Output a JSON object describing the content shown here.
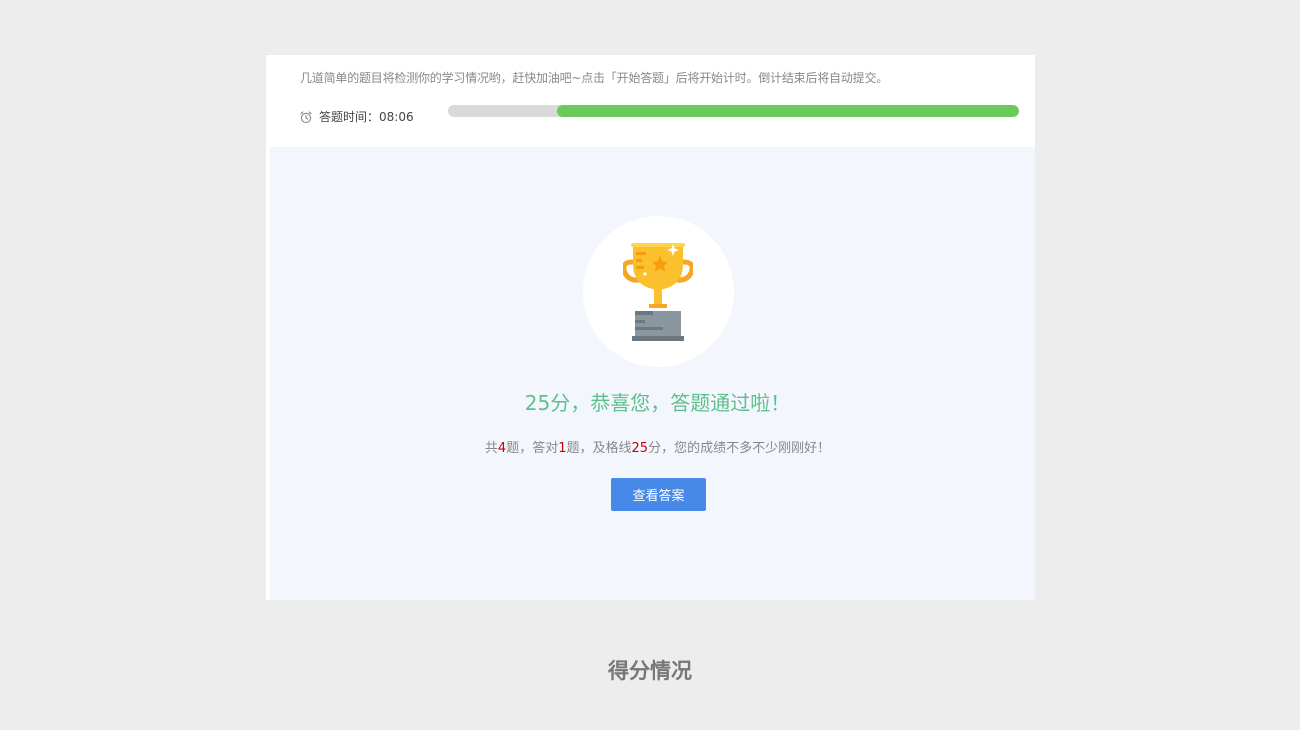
{
  "quiz": {
    "intro": "几道简单的题目将检测你的学习情况哟，赶快加油吧~点击「开始答题」后将开始计时。倒计结束后将自动提交。",
    "timer_label": "答题时间：",
    "timer_value": "08:06",
    "time_remaining_fraction": 0.81,
    "icons": {
      "timer": "alarm-clock-icon",
      "trophy": "trophy-icon"
    },
    "colors": {
      "progress_fill": "#6cc95c",
      "progress_track": "#d9d9d9",
      "title": "#5fbf8c",
      "highlight": "#cc0000",
      "button": "#4689e8"
    }
  },
  "result": {
    "title": "25分，恭喜您，答题通过啦！",
    "detail": {
      "p1": "共",
      "total": "4",
      "p2": "题，答对",
      "correct": "1",
      "p3": "题，及格线",
      "pass_line": "25",
      "p4": "分，您的成绩不多不少刚刚好！"
    },
    "view_answer_label": "查看答案"
  },
  "caption": "得分情况"
}
